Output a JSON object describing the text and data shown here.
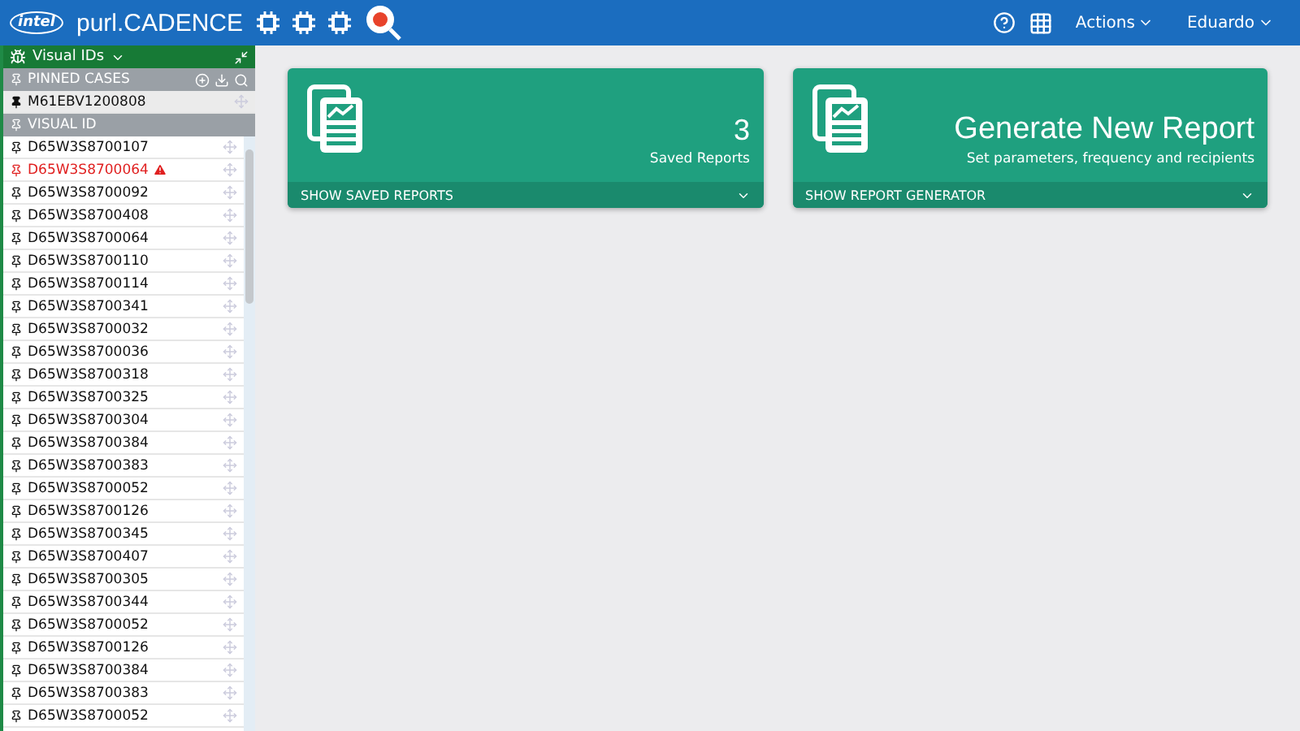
{
  "header": {
    "logo": "intel",
    "title": "purl.CADENCE",
    "menus": [
      {
        "label": "Actions"
      },
      {
        "label": "Eduardo"
      }
    ]
  },
  "sidebar": {
    "title": "Visual IDs",
    "pinned": {
      "title": "PINNED CASES",
      "items": [
        {
          "label": "M61EBV1200808"
        }
      ]
    },
    "visual": {
      "title": "VISUAL ID",
      "items": [
        {
          "label": "D65W3S8700107",
          "alert": false
        },
        {
          "label": "D65W3S8700064",
          "alert": true
        },
        {
          "label": "D65W3S8700092",
          "alert": false
        },
        {
          "label": "D65W3S8700408",
          "alert": false
        },
        {
          "label": "D65W3S8700064",
          "alert": false
        },
        {
          "label": "D65W3S8700110",
          "alert": false
        },
        {
          "label": "D65W3S8700114",
          "alert": false
        },
        {
          "label": "D65W3S8700341",
          "alert": false
        },
        {
          "label": "D65W3S8700032",
          "alert": false
        },
        {
          "label": "D65W3S8700036",
          "alert": false
        },
        {
          "label": "D65W3S8700318",
          "alert": false
        },
        {
          "label": "D65W3S8700325",
          "alert": false
        },
        {
          "label": "D65W3S8700304",
          "alert": false
        },
        {
          "label": "D65W3S8700384",
          "alert": false
        },
        {
          "label": "D65W3S8700383",
          "alert": false
        },
        {
          "label": "D65W3S8700052",
          "alert": false
        },
        {
          "label": "D65W3S8700126",
          "alert": false
        },
        {
          "label": "D65W3S8700345",
          "alert": false
        },
        {
          "label": "D65W3S8700407",
          "alert": false
        },
        {
          "label": "D65W3S8700305",
          "alert": false
        },
        {
          "label": "D65W3S8700344",
          "alert": false
        },
        {
          "label": "D65W3S8700052",
          "alert": false
        },
        {
          "label": "D65W3S8700126",
          "alert": false
        },
        {
          "label": "D65W3S8700384",
          "alert": false
        },
        {
          "label": "D65W3S8700383",
          "alert": false
        },
        {
          "label": "D65W3S8700052",
          "alert": false
        }
      ]
    }
  },
  "cards": [
    {
      "kind": "count",
      "value": "3",
      "caption": "Saved Reports",
      "footer": "SHOW SAVED REPORTS"
    },
    {
      "kind": "action",
      "value": "Generate New Report",
      "caption": "Set parameters, frequency and recipients",
      "footer": "SHOW REPORT GENERATOR"
    }
  ]
}
